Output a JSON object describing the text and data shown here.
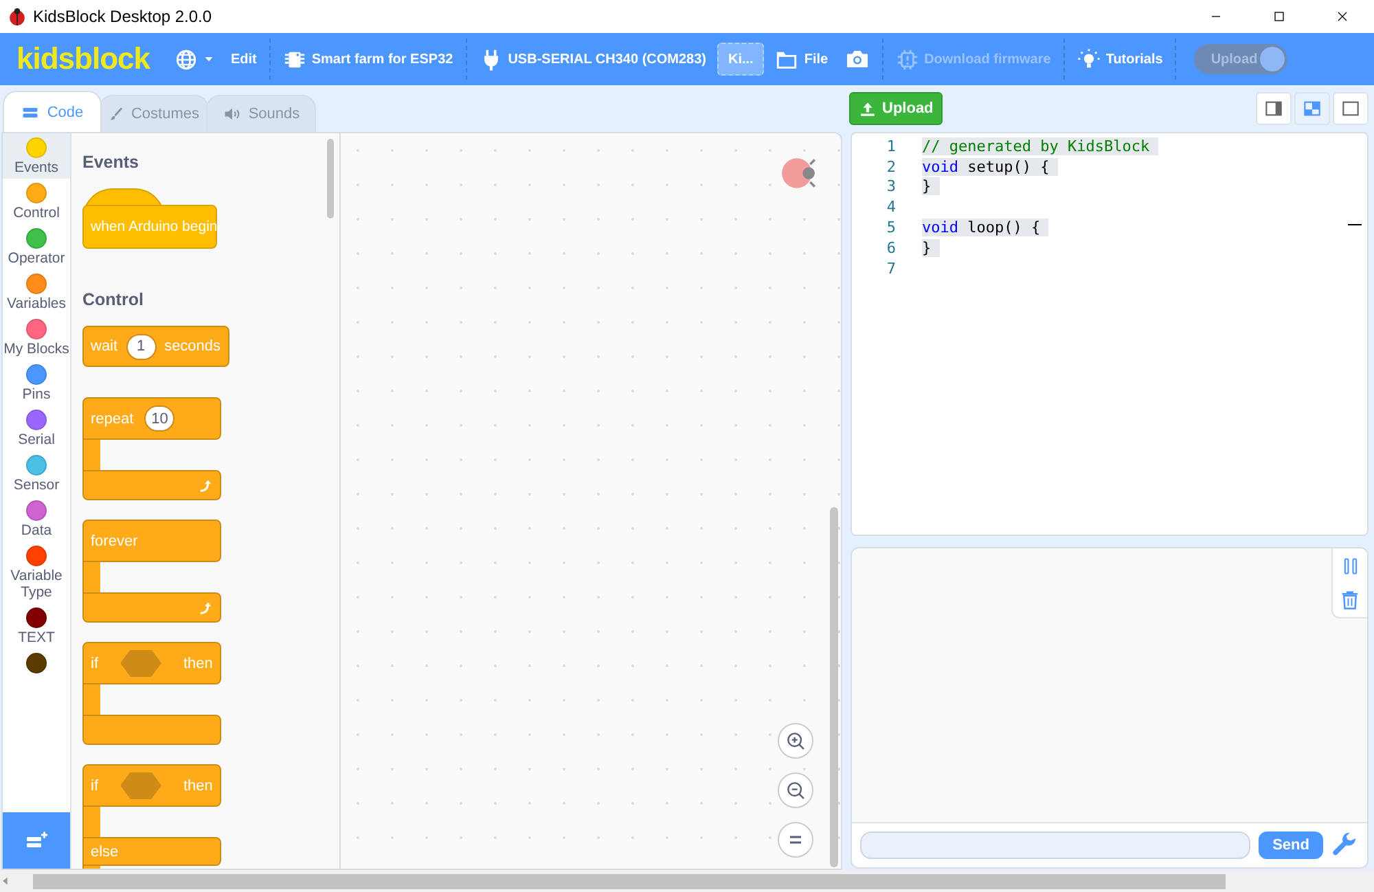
{
  "window": {
    "title": "KidsBlock Desktop 2.0.0"
  },
  "menubar": {
    "logo": "kidsblock",
    "items": [
      {
        "kind": "language"
      },
      {
        "kind": "text",
        "label": "Edit"
      },
      {
        "kind": "divider"
      },
      {
        "kind": "chip",
        "label": "Smart farm for ESP32"
      },
      {
        "kind": "divider"
      },
      {
        "kind": "plug",
        "label": "USB-SERIAL CH340 (COM283)"
      },
      {
        "kind": "project",
        "label": "Ki..."
      },
      {
        "kind": "folder",
        "label": "File"
      },
      {
        "kind": "camera"
      },
      {
        "kind": "divider"
      },
      {
        "kind": "firmware",
        "label": "Download firmware",
        "disabled": true
      },
      {
        "kind": "divider"
      },
      {
        "kind": "bulb",
        "label": "Tutorials"
      },
      {
        "kind": "divider"
      },
      {
        "kind": "toggle",
        "label": "Upload",
        "on": false
      }
    ]
  },
  "tabs": [
    {
      "label": "Code",
      "kind": "code",
      "selected": true
    },
    {
      "label": "Costumes",
      "kind": "brush",
      "selected": false
    },
    {
      "label": "Sounds",
      "kind": "sound",
      "selected": false
    }
  ],
  "categories": [
    {
      "label": "Events",
      "color": "#ffd500",
      "selected": true
    },
    {
      "label": "Control",
      "color": "#ffab19",
      "selected": false
    },
    {
      "label": "Operator",
      "color": "#40bf4a",
      "selected": false
    },
    {
      "label": "Variables",
      "color": "#ff8c1a",
      "selected": false
    },
    {
      "label": "My Blocks",
      "color": "#ff6680",
      "selected": false
    },
    {
      "label": "Pins",
      "color": "#4c97ff",
      "selected": false
    },
    {
      "label": "Serial",
      "color": "#9966ff",
      "selected": false
    },
    {
      "label": "Sensor",
      "color": "#4cbfe6",
      "selected": false
    },
    {
      "label": "Data",
      "color": "#cf63cf",
      "selected": false
    },
    {
      "label": "Variable Type",
      "color": "#ff4000",
      "selected": false
    },
    {
      "label": "TEXT",
      "color": "#800000",
      "selected": false
    },
    {
      "color": "#5c3b00",
      "selected": false
    }
  ],
  "flyout": [
    {
      "kind": "heading",
      "label": "Events"
    },
    {
      "kind": "hat",
      "label": "when Arduino begin"
    },
    {
      "kind": "heading",
      "label": "Control"
    },
    {
      "kind": "stack",
      "label": "wait",
      "input": "1",
      "label_after": "seconds"
    },
    {
      "kind": "c",
      "label": "repeat",
      "input": "10",
      "loop": true
    },
    {
      "kind": "c",
      "label": "forever",
      "loop": true
    },
    {
      "kind": "c-cond",
      "label": "if",
      "label_after": "then"
    },
    {
      "kind": "c-else",
      "label": "if",
      "label_after": "then",
      "else_label": "else"
    }
  ],
  "code_toolbar": {
    "upload": "Upload",
    "layouts": [
      {
        "kind": "narrow",
        "selected": false
      },
      {
        "kind": "split",
        "selected": true
      },
      {
        "kind": "full",
        "selected": false
      }
    ]
  },
  "code": [
    {
      "number": "1",
      "tokens": [
        {
          "kind": "comment",
          "text": "// generated by KidsBlock"
        }
      ]
    },
    {
      "number": "2",
      "tokens": [
        {
          "kind": "keyword",
          "text": "void"
        },
        {
          "kind": "plain",
          "text": " setup() {"
        }
      ]
    },
    {
      "number": "3",
      "tokens": [
        {
          "kind": "plain",
          "text": "}"
        }
      ]
    },
    {
      "number": "4"
    },
    {
      "number": "5",
      "tokens": [
        {
          "kind": "keyword",
          "text": "void"
        },
        {
          "kind": "plain",
          "text": " loop() {"
        }
      ]
    },
    {
      "number": "6",
      "tokens": [
        {
          "kind": "plain",
          "text": "}"
        }
      ]
    },
    {
      "number": "7"
    }
  ],
  "serial": {
    "send": "Send"
  }
}
